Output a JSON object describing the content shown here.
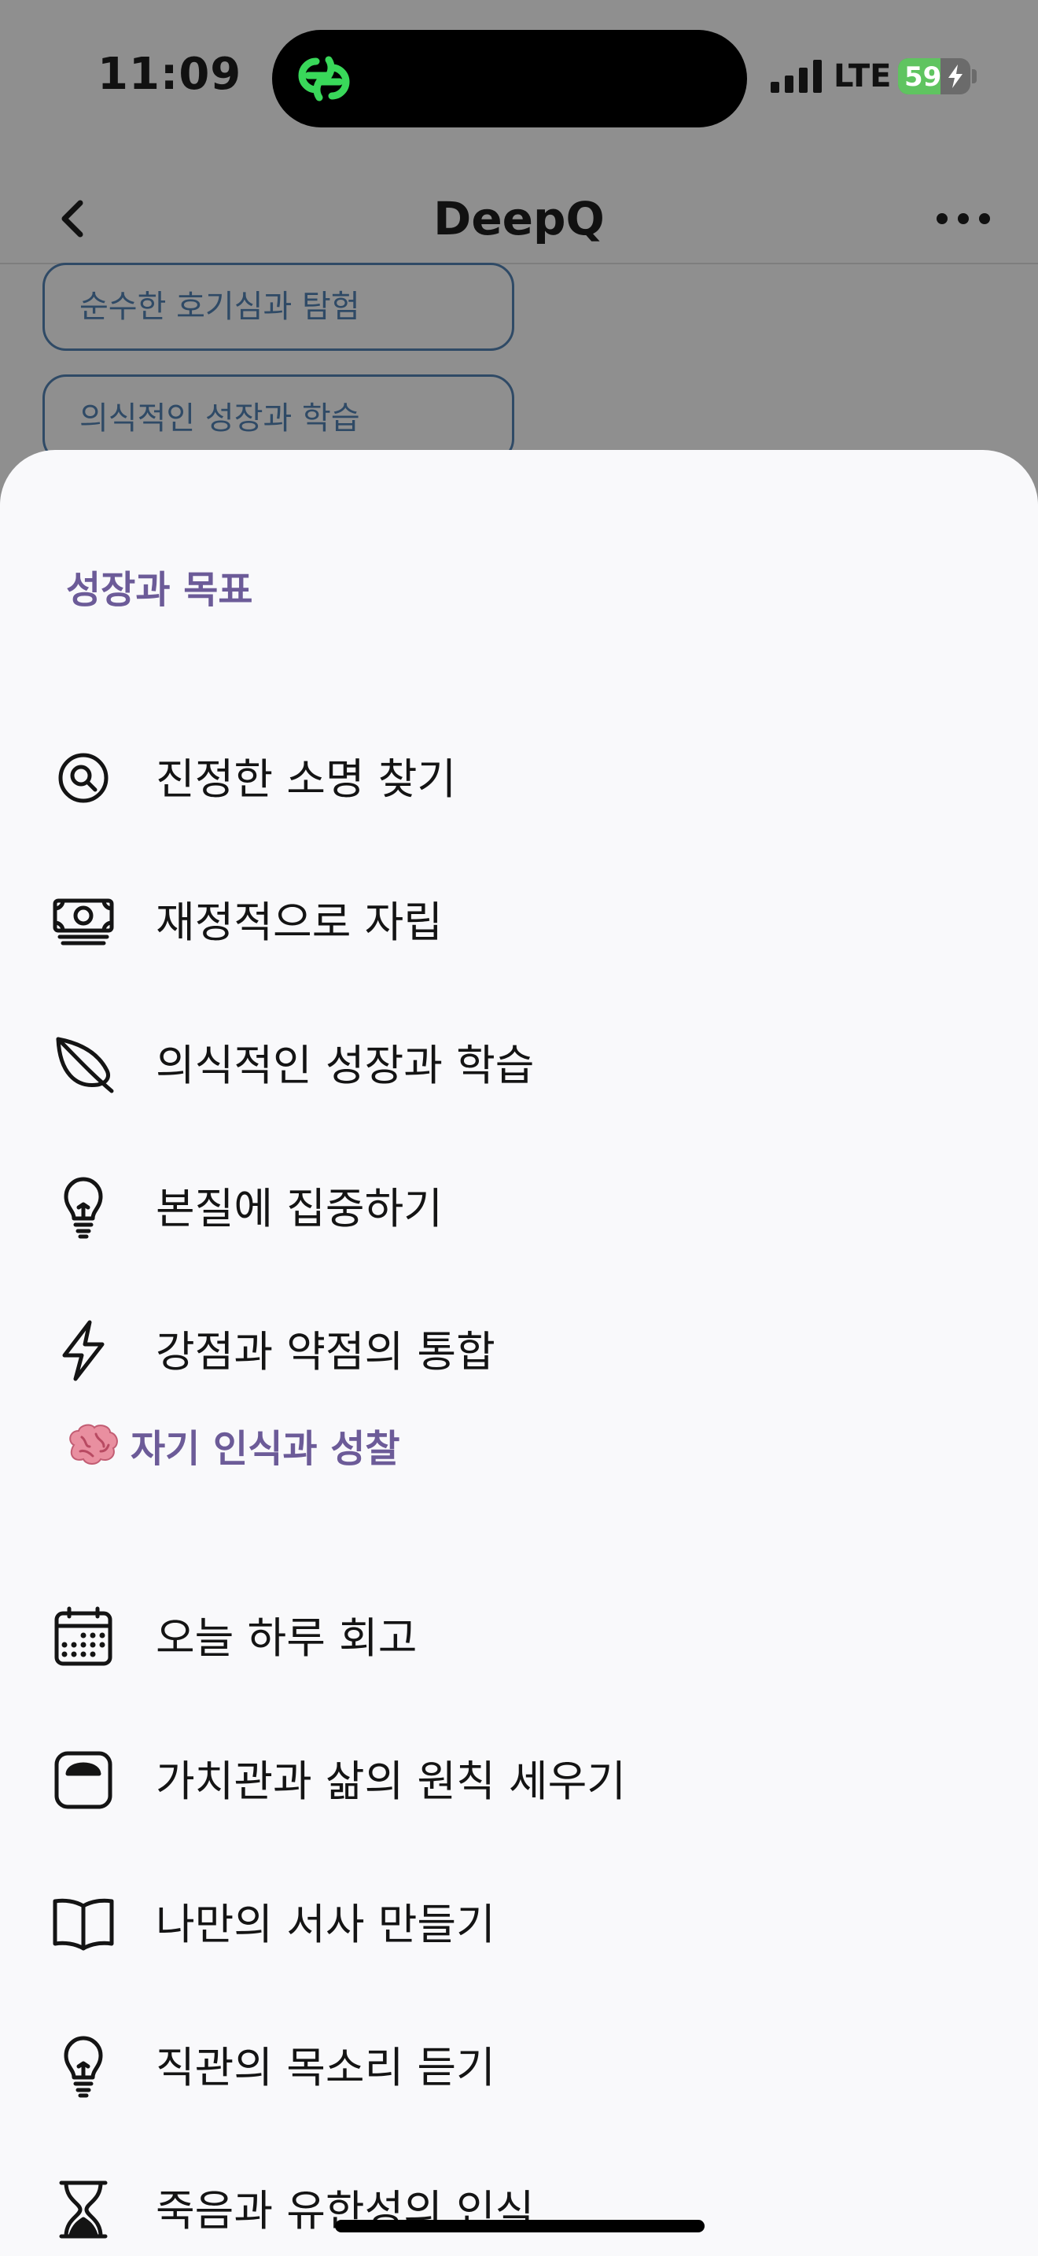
{
  "status_bar": {
    "time": "11:09",
    "network": "LTE",
    "battery_level": "59",
    "battery_fraction": 0.59,
    "island_app_icon": "link-rings-icon",
    "accent_green": "#39d85a"
  },
  "nav": {
    "title": "DeepQ",
    "back_icon": "chevron-left-icon",
    "more_icon": "ellipsis-icon"
  },
  "background_chips": [
    "순수한 호기심과 탐험",
    "의식적인 성장과 학습"
  ],
  "sheet": {
    "sections": [
      {
        "header": "성장과 목표",
        "header_icon": null,
        "items": [
          {
            "label": "진정한 소명 찾기",
            "icon": "search-circle-icon"
          },
          {
            "label": "재정적으로 자립",
            "icon": "money-stack-icon"
          },
          {
            "label": "의식적인 성장과 학습",
            "icon": "leaf-icon"
          },
          {
            "label": "본질에 집중하기",
            "icon": "lightbulb-icon"
          },
          {
            "label": "강점과 약점의 통합",
            "icon": "lightning-icon"
          }
        ]
      },
      {
        "header": "자기 인식과 성찰",
        "header_icon": "brain-icon",
        "items": [
          {
            "label": "오늘 하루 회고",
            "icon": "calendar-icon"
          },
          {
            "label": "가치관과 삶의 원칙 세우기",
            "icon": "scale-icon"
          },
          {
            "label": "나만의 서사 만들기",
            "icon": "open-book-icon"
          },
          {
            "label": "직관의 목소리 듣기",
            "icon": "lightbulb-icon"
          },
          {
            "label": "죽음과 유한성의 인식",
            "icon": "hourglass-icon"
          }
        ]
      }
    ]
  },
  "colors": {
    "section_header": "#6c5b98",
    "sheet_background": "#f9f9fb",
    "dimmed_background": "#8f8f8f"
  }
}
